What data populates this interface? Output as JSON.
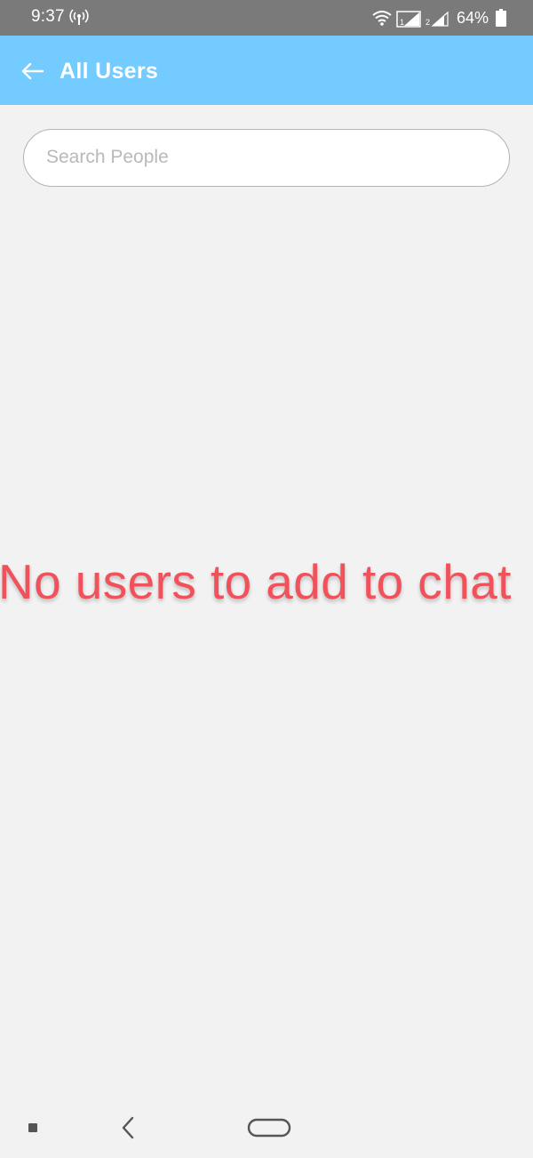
{
  "status_bar": {
    "time": "9:37",
    "battery_percent": "64%",
    "icons": [
      "hotspot-icon",
      "wifi-icon",
      "sim1-signal-icon",
      "sim2-signal-icon",
      "battery-icon"
    ]
  },
  "app_bar": {
    "title": "All Users",
    "back_icon": "arrow-left-icon",
    "background_color": "#73cbff"
  },
  "search": {
    "placeholder": "Search People",
    "value": ""
  },
  "empty_state": {
    "message": "No users to add to chat",
    "color": "#f1515a"
  },
  "nav_bar": {
    "icons": [
      "recents-icon",
      "back-icon",
      "home-icon"
    ]
  }
}
